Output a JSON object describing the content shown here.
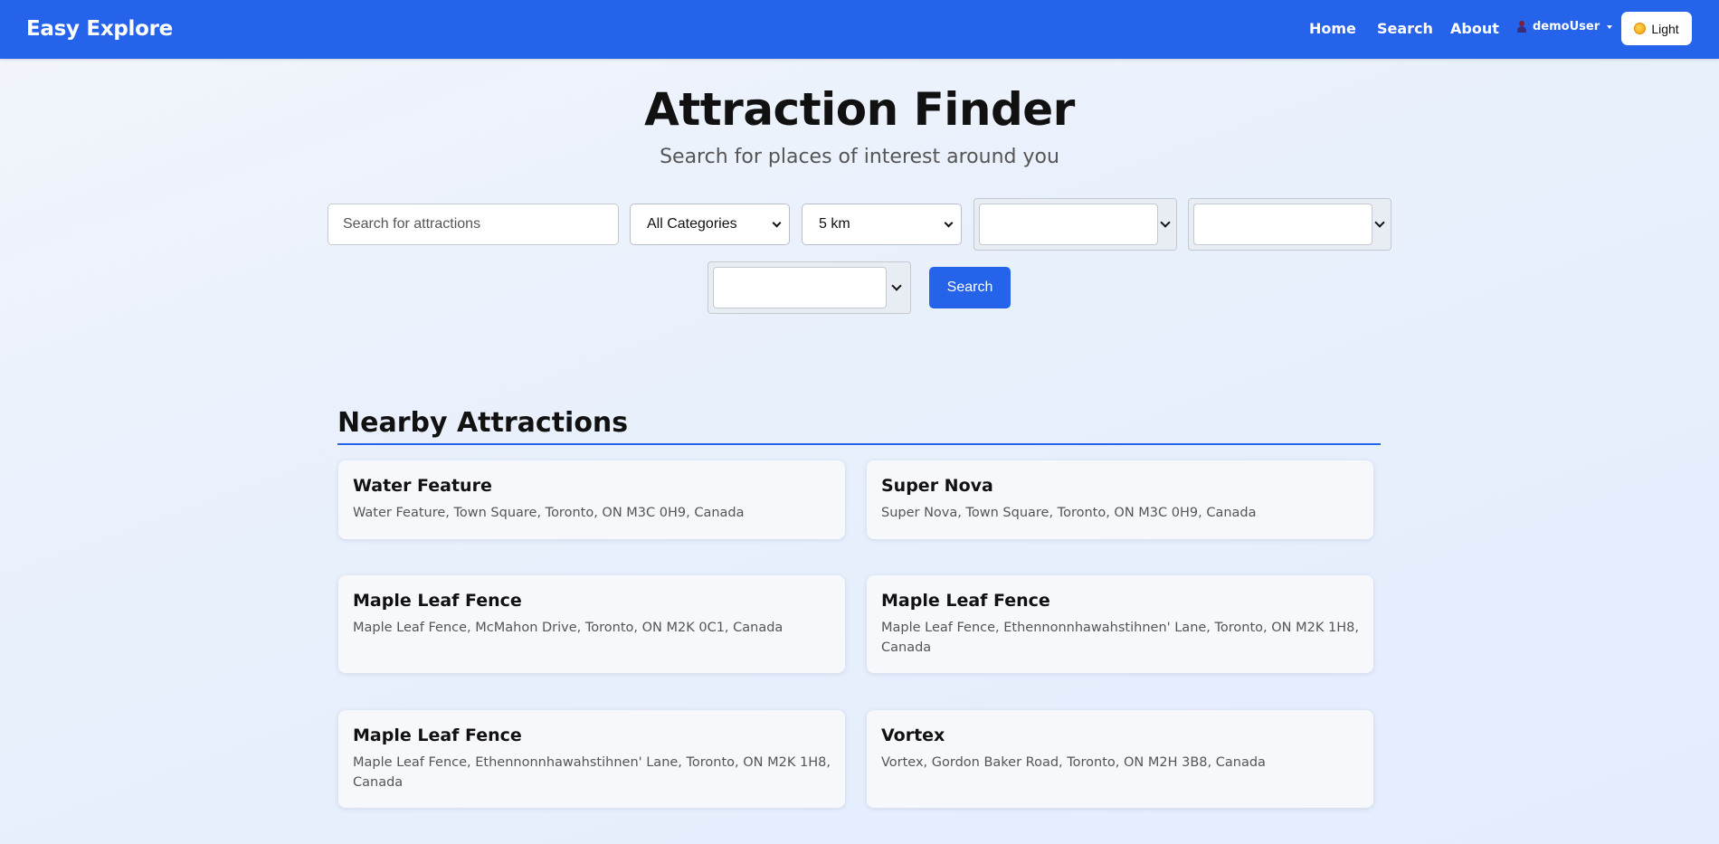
{
  "navbar": {
    "brand": "Easy Explore",
    "links": [
      "Home",
      "Search",
      "About"
    ],
    "user": "demoUser",
    "theme_label": "Light",
    "accent": "#2563eb"
  },
  "hero": {
    "title": "Attraction Finder",
    "subtitle": "Search for places of interest around you"
  },
  "search": {
    "placeholder": "Search for attractions",
    "category_selected": "All Categories",
    "distance_selected": "5 km",
    "button_label": "Search"
  },
  "results": {
    "heading": "Nearby Attractions",
    "items": [
      {
        "name": "Water Feature",
        "address": "Water Feature, Town Square, Toronto, ON M3C 0H9, Canada"
      },
      {
        "name": "Super Nova",
        "address": "Super Nova, Town Square, Toronto, ON M3C 0H9, Canada"
      },
      {
        "name": "Maple Leaf Fence",
        "address": "Maple Leaf Fence, McMahon Drive, Toronto, ON M2K 0C1, Canada"
      },
      {
        "name": "Maple Leaf Fence",
        "address": "Maple Leaf Fence, Ethennonnhawahstihnen' Lane, Toronto, ON M2K 1H8, Canada"
      },
      {
        "name": "Maple Leaf Fence",
        "address": "Maple Leaf Fence, Ethennonnhawahstihnen' Lane, Toronto, ON M2K 1H8, Canada"
      },
      {
        "name": "Vortex",
        "address": "Vortex, Gordon Baker Road, Toronto, ON M2H 3B8, Canada"
      }
    ]
  }
}
